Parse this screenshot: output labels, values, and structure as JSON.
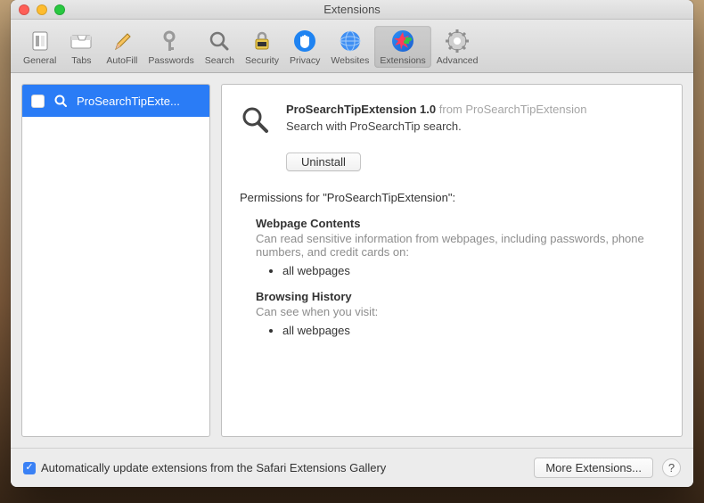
{
  "window": {
    "title": "Extensions"
  },
  "toolbar": {
    "items": [
      {
        "label": "General"
      },
      {
        "label": "Tabs"
      },
      {
        "label": "AutoFill"
      },
      {
        "label": "Passwords"
      },
      {
        "label": "Search"
      },
      {
        "label": "Security"
      },
      {
        "label": "Privacy"
      },
      {
        "label": "Websites"
      },
      {
        "label": "Extensions",
        "selected": true
      },
      {
        "label": "Advanced"
      }
    ]
  },
  "sidebar": {
    "items": [
      {
        "name": "ProSearchTipExte...",
        "checked": false
      }
    ]
  },
  "detail": {
    "name": "ProSearchTipExtension",
    "version": "1.0",
    "from_label": "from ProSearchTipExtension",
    "description": "Search with ProSearchTip search.",
    "uninstall_label": "Uninstall",
    "permissions_header": "Permissions for \"ProSearchTipExtension\":",
    "permissions": [
      {
        "title": "Webpage Contents",
        "desc": "Can read sensitive information from webpages, including passwords, phone numbers, and credit cards on:",
        "scopes": [
          "all webpages"
        ]
      },
      {
        "title": "Browsing History",
        "desc": "Can see when you visit:",
        "scopes": [
          "all webpages"
        ]
      }
    ]
  },
  "footer": {
    "auto_update_label": "Automatically update extensions from the Safari Extensions Gallery",
    "auto_update_checked": true,
    "more_ext_label": "More Extensions...",
    "help_label": "?"
  },
  "colors": {
    "selection": "#2a7cf6",
    "accent": "#3a81f5"
  }
}
